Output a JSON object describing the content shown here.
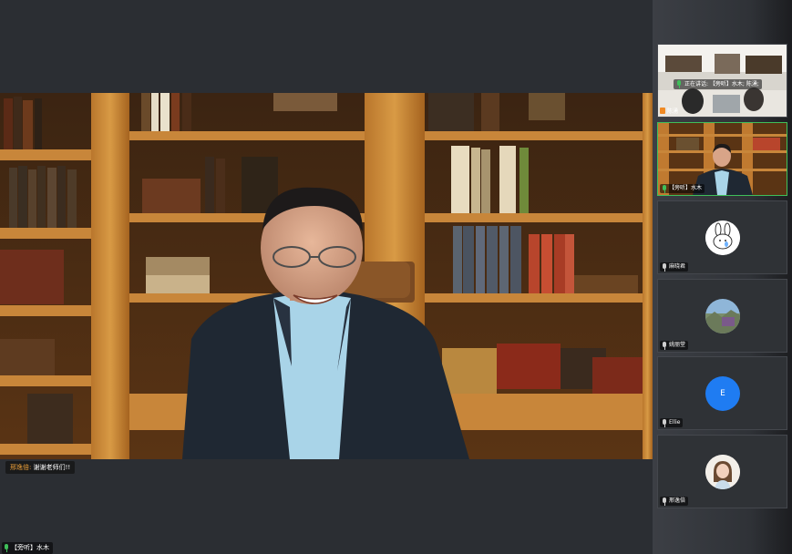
{
  "main": {
    "active_speaker_name": "【旁听】水木",
    "chat_toast": {
      "sender": "邢逸倍:",
      "message": "谢谢老师们!!"
    }
  },
  "sidebar": {
    "tiles": [
      {
        "name": "陈湧",
        "overlay": "正在讲话: 【旁听】水木; 陈湧;",
        "type": "video"
      },
      {
        "name": "【旁听】水木",
        "type": "video"
      },
      {
        "name": "麻晓君",
        "type": "avatar",
        "avatar": "bunny-avatar"
      },
      {
        "name": "姚丽堂",
        "type": "avatar",
        "avatar": "landscape-avatar"
      },
      {
        "name": "Ellie",
        "type": "avatar",
        "avatar": "letter-avatar",
        "letter": "E"
      },
      {
        "name": "邢逸倍",
        "type": "avatar",
        "avatar": "girl-avatar"
      }
    ]
  },
  "colors": {
    "mic_active": "#3fbf5a",
    "letter_avatar_bg": "#1f7cf2",
    "chat_sender": "#f0a23a",
    "background": "#2b2e33"
  }
}
